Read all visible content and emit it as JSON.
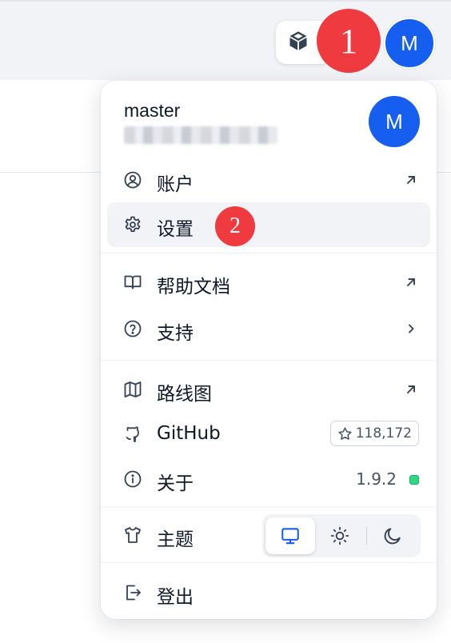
{
  "header": {
    "cube_icon": "cube-icon",
    "avatar_initial": "M",
    "marker_1": "1"
  },
  "menu": {
    "user": {
      "name": "master",
      "avatar_initial": "M"
    },
    "items": {
      "account": {
        "label": "账户",
        "icon": "user-circle-icon",
        "right_icon": "external-arrow-icon"
      },
      "settings": {
        "label": "设置",
        "icon": "gear-icon"
      },
      "help_docs": {
        "label": "帮助文档",
        "icon": "book-icon",
        "right_icon": "external-arrow-icon"
      },
      "support": {
        "label": "支持",
        "icon": "question-circle-icon",
        "right_icon": "chevron-right-icon"
      },
      "roadmap": {
        "label": "路线图",
        "icon": "map-icon",
        "right_icon": "external-arrow-icon"
      },
      "github": {
        "label": "GitHub",
        "icon": "github-icon",
        "stars": "118,172"
      },
      "about": {
        "label": "关于",
        "icon": "info-circle-icon",
        "version": "1.9.2"
      },
      "theme": {
        "label": "主题",
        "icon": "shirt-icon",
        "options": [
          "system",
          "light",
          "dark"
        ],
        "selected": "system"
      },
      "logout": {
        "label": "登出",
        "icon": "logout-icon"
      }
    },
    "marker_2": "2"
  },
  "colors": {
    "accent": "#155eef",
    "marker": "#ef3a3f",
    "status_ok": "#32d583"
  }
}
